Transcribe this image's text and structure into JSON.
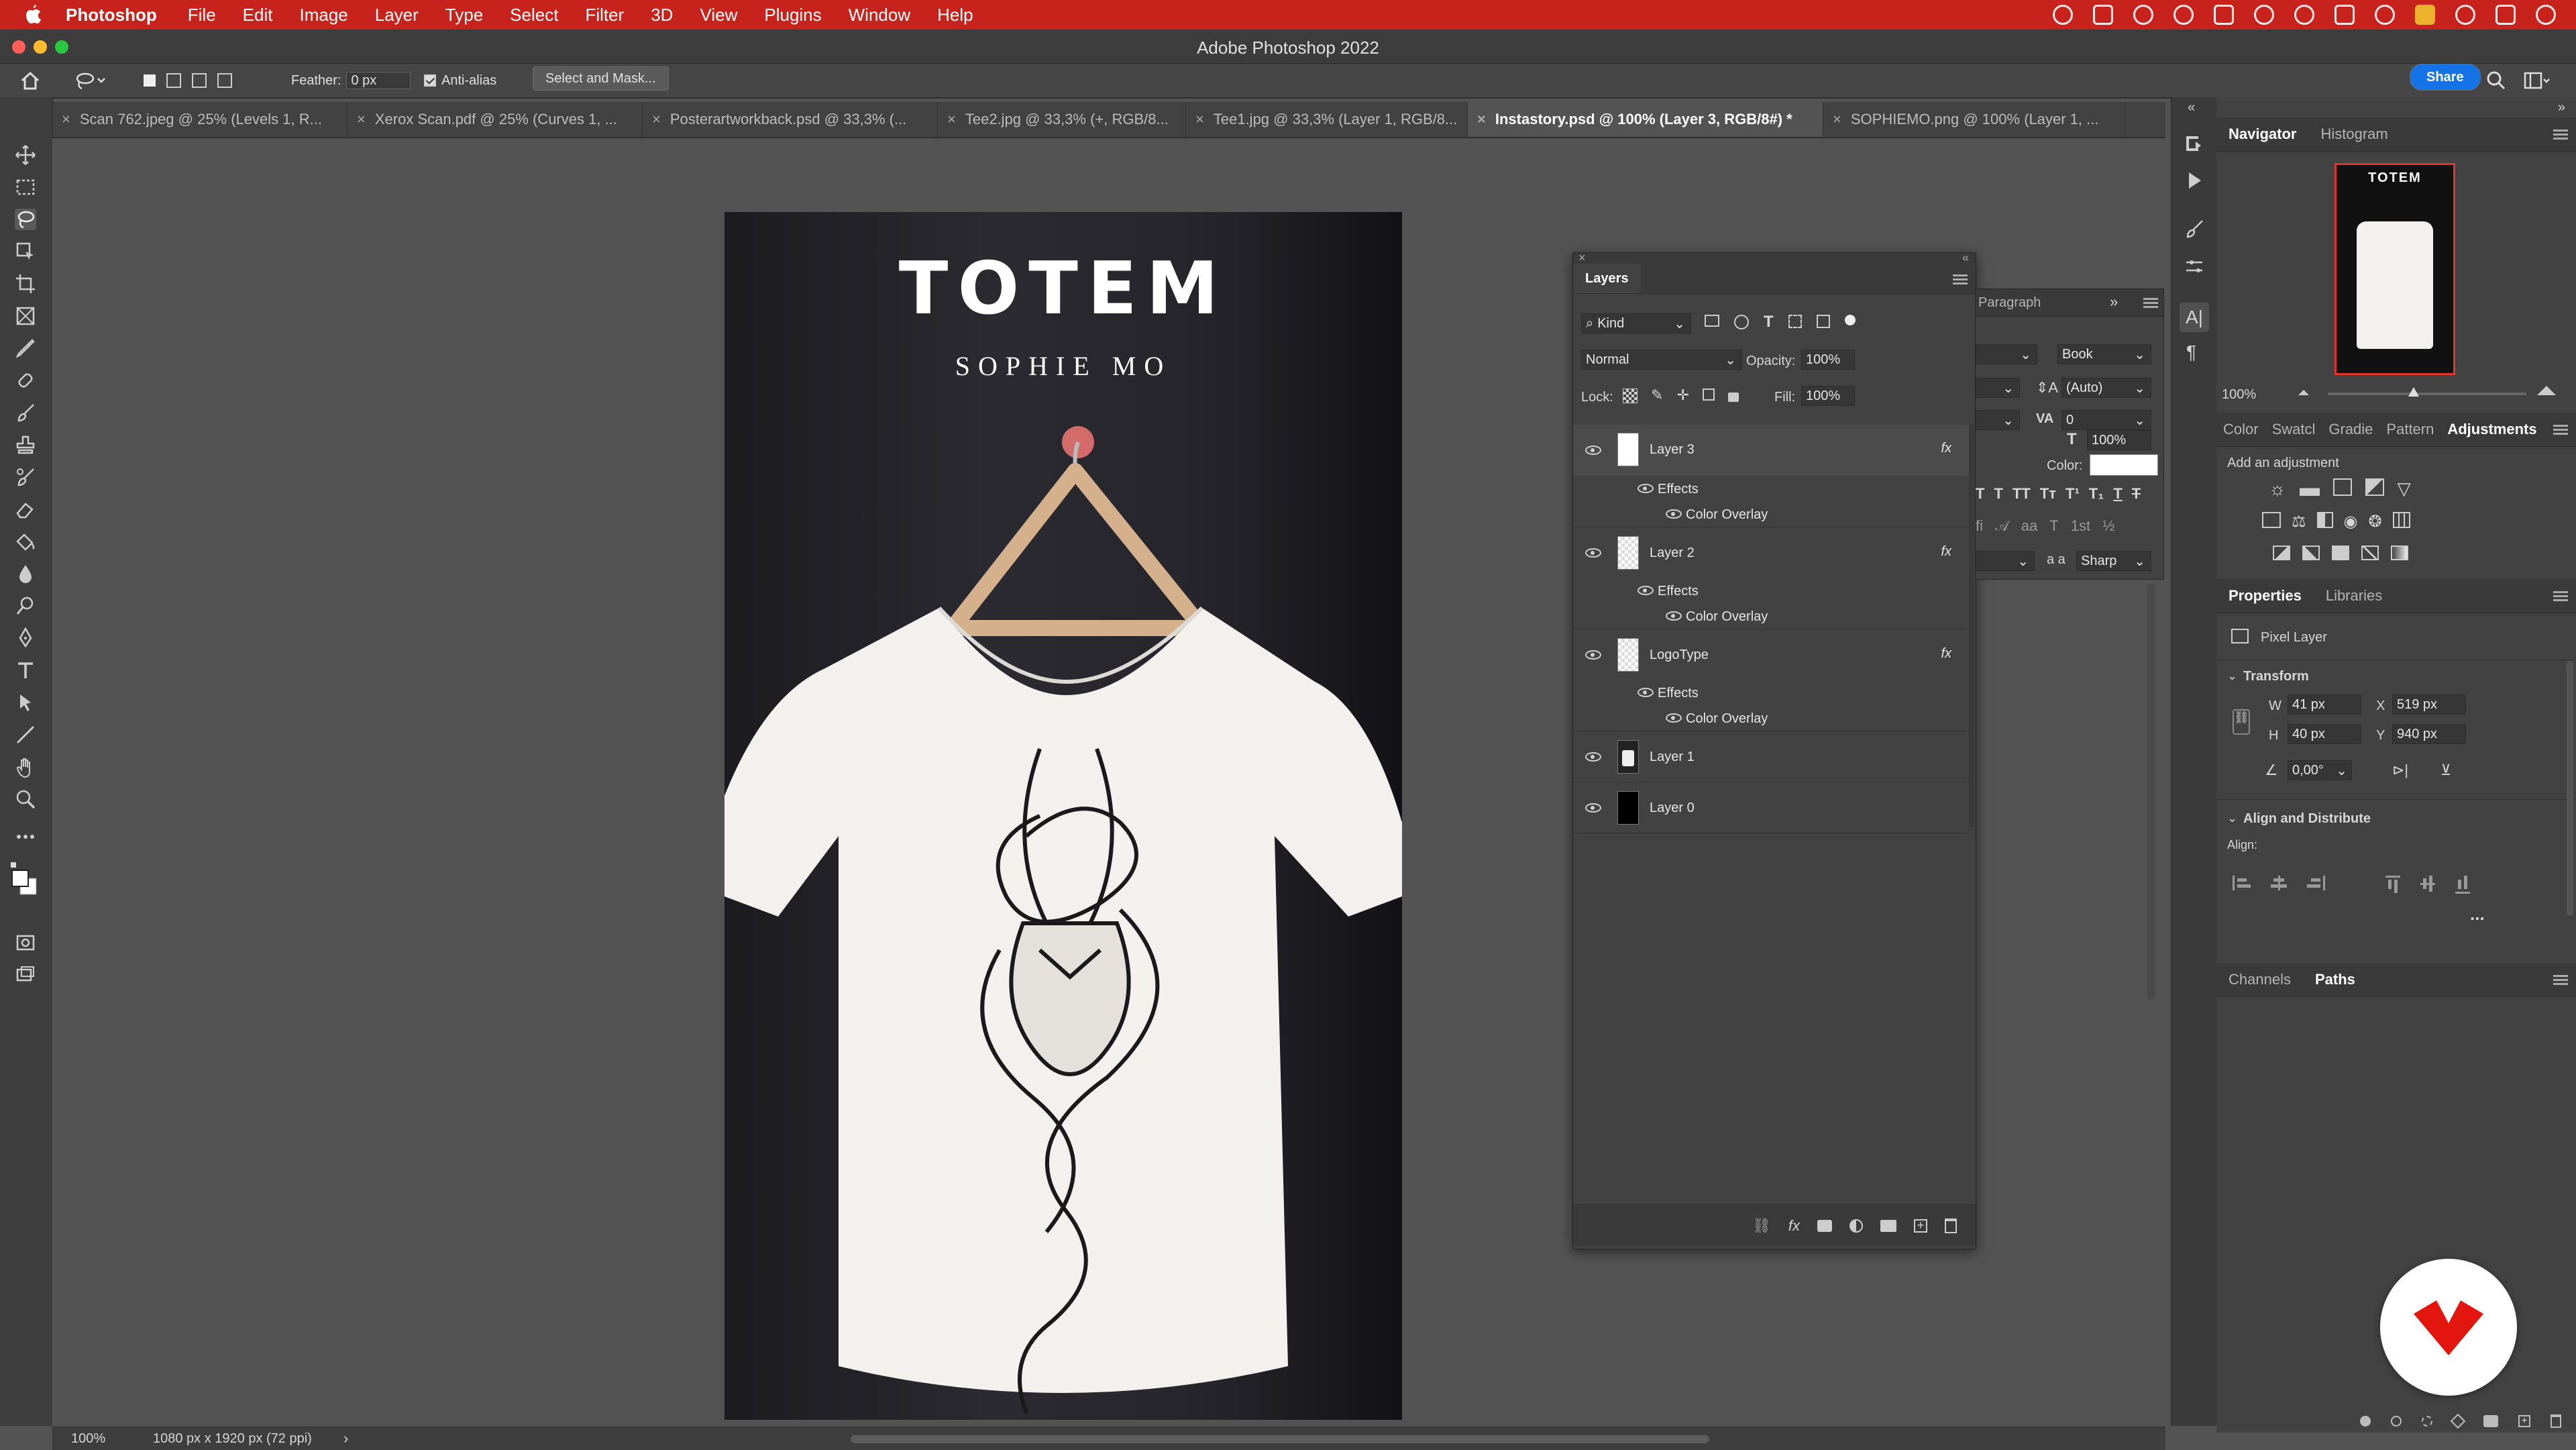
{
  "menubar": {
    "app_name": "Photoshop",
    "items": [
      "File",
      "Edit",
      "Image",
      "Layer",
      "Type",
      "Select",
      "Filter",
      "3D",
      "View",
      "Plugins",
      "Window",
      "Help"
    ]
  },
  "window": {
    "title": "Adobe Photoshop 2022"
  },
  "options": {
    "feather_label": "Feather:",
    "feather_value": "0 px",
    "antialias_label": "Anti-alias",
    "select_mask_label": "Select and Mask...",
    "share_label": "Share"
  },
  "tabs": [
    {
      "label": "Scan 762.jpeg @ 25% (Levels 1, R..."
    },
    {
      "label": "Xerox Scan.pdf @ 25% (Curves 1, ..."
    },
    {
      "label": "Posterartworkback.psd @ 33,3% (..."
    },
    {
      "label": "Tee2.jpg @ 33,3% (+, RGB/8..."
    },
    {
      "label": "Tee1.jpg @ 33,3% (Layer 1, RGB/8..."
    },
    {
      "label": "Instastory.psd @ 100% (Layer 3, RGB/8#) *"
    },
    {
      "label": "SOPHIEMO.png @ 100% (Layer 1, ..."
    }
  ],
  "artwork": {
    "title": "TOTEM",
    "subtitle": "SOPHIE MO"
  },
  "layers": {
    "panel_title": "Layers",
    "filter_kind": "Kind",
    "blend_mode": "Normal",
    "opacity_label": "Opacity:",
    "opacity_value": "100%",
    "lock_label": "Lock:",
    "fill_label": "Fill:",
    "fill_value": "100%",
    "items": [
      {
        "name": "Layer 3",
        "effects": "Effects",
        "effect_item": "Color Overlay"
      },
      {
        "name": "Layer 2",
        "effects": "Effects",
        "effect_item": "Color Overlay"
      },
      {
        "name": "LogoType",
        "effects": "Effects",
        "effect_item": "Color Overlay"
      },
      {
        "name": "Layer 1"
      },
      {
        "name": "Layer 0"
      }
    ],
    "fx_label": "fx"
  },
  "paragraph": {
    "tab_label": "Paragraph",
    "font_style": "Book",
    "leading": "(Auto)",
    "tracking": "0",
    "scale": "100%",
    "color_label": "Color:",
    "antialias": "Sharp",
    "aa_label": "a a"
  },
  "navigator": {
    "tabs": [
      "Navigator",
      "Histogram"
    ],
    "zoom": "100%",
    "thumb_title": "TOTEM"
  },
  "adjust_tabs": [
    "Color",
    "Swatcl",
    "Gradie",
    "Pattern",
    "Adjustments"
  ],
  "adjust_hint": "Add an adjustment",
  "properties": {
    "tabs": [
      "Properties",
      "Libraries"
    ],
    "kind": "Pixel Layer",
    "transform_label": "Transform",
    "w_label": "W",
    "w_value": "41 px",
    "h_label": "H",
    "h_value": "40 px",
    "x_label": "X",
    "x_value": "519 px",
    "y_label": "Y",
    "y_value": "940 px",
    "angle": "0,00°",
    "align_label": "Align and Distribute",
    "align_sub": "Align:",
    "more": "..."
  },
  "bottom_tabs": [
    "Channels",
    "Paths"
  ],
  "status": {
    "zoom": "100%",
    "doc_info": "1080 px x 1920 px (72 ppi)"
  },
  "colors": {
    "menubar": "#c7221b",
    "accent_blue": "#1473e6"
  }
}
